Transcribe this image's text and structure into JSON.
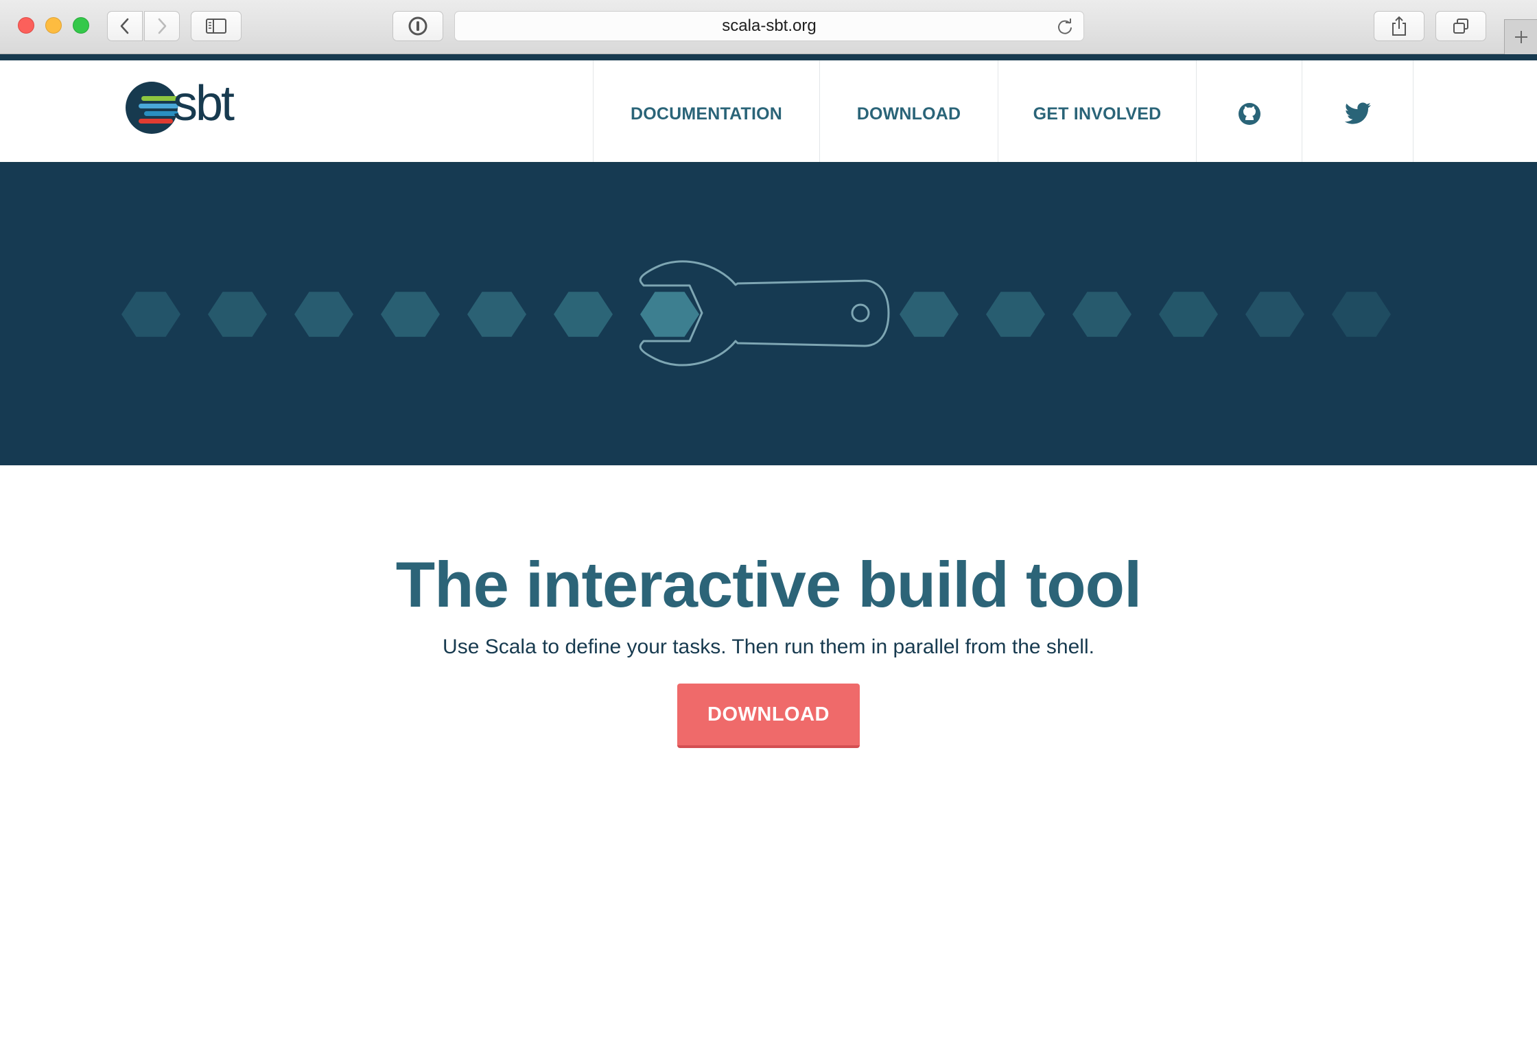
{
  "browser": {
    "url": "scala-sbt.org"
  },
  "header": {
    "logo_text": "sbt",
    "nav": [
      {
        "label": "DOCUMENTATION"
      },
      {
        "label": "DOWNLOAD"
      },
      {
        "label": "GET INVOLVED"
      }
    ],
    "social_icons": [
      "github-icon",
      "twitter-icon"
    ]
  },
  "hero": {
    "illustration": "wrench-icon",
    "colors": {
      "background": "#163a52",
      "hexagon": "#2f6a7b",
      "hexagon_active": "#3d7f90",
      "wrench_outline": "#7ea6b3"
    }
  },
  "main": {
    "headline": "The interactive build tool",
    "subline": "Use Scala to define your tasks. Then run them in parallel from the shell.",
    "download_button": "DOWNLOAD"
  },
  "colors": {
    "brand_dark": "#173a4f",
    "brand_teal": "#2c6478",
    "cta": "#ef6a6a"
  }
}
